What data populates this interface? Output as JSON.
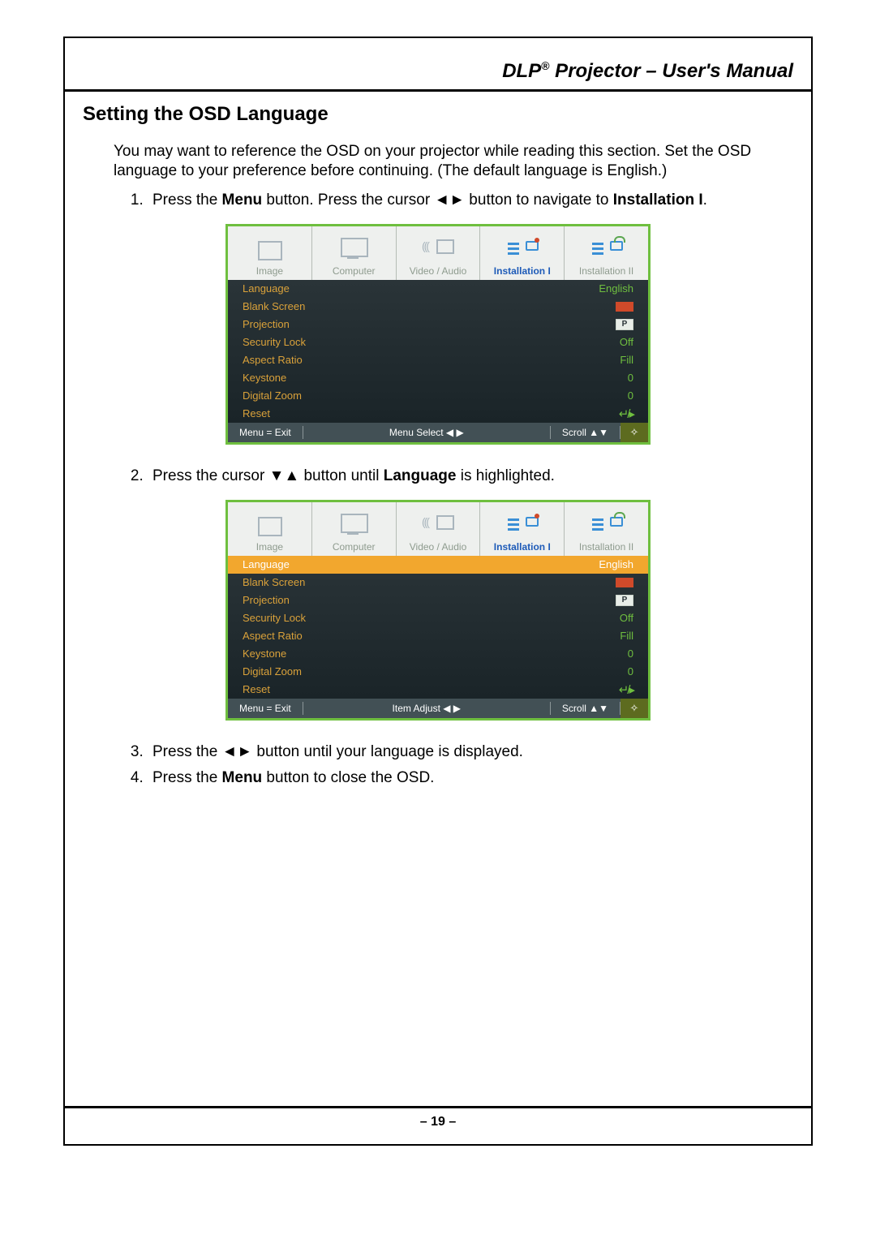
{
  "header": {
    "title_prefix": "DLP",
    "title_reg": "®",
    "title_suffix": " Projector – User's Manual"
  },
  "section_title": "Setting the OSD Language",
  "intro_para": "You may want to reference the OSD on your projector while reading this section. Set the OSD language to your preference before continuing. (The default language is English.)",
  "steps": {
    "s1_a": "Press the ",
    "s1_menu": "Menu",
    "s1_b": " button. Press the cursor ◄► button to navigate to ",
    "s1_inst": "Installation I",
    "s1_c": ".",
    "s2_a": "Press the cursor ▼▲ button until ",
    "s2_lang": "Language",
    "s2_b": " is highlighted.",
    "s3": "Press the ◄► button until your language is displayed.",
    "s4_a": "Press the ",
    "s4_menu": "Menu",
    "s4_b": " button to close the OSD."
  },
  "osd": {
    "tabs": {
      "image": "Image",
      "computer": "Computer",
      "va": "Video / Audio",
      "inst1": "Installation I",
      "inst2": "Installation II"
    },
    "rows": [
      {
        "label": "Language",
        "value": "English",
        "type": "text"
      },
      {
        "label": "Blank Screen",
        "value": "",
        "type": "swatch"
      },
      {
        "label": "Projection",
        "value": "P",
        "type": "proj"
      },
      {
        "label": "Security Lock",
        "value": "Off",
        "type": "text"
      },
      {
        "label": "Aspect Ratio",
        "value": "Fill",
        "type": "text"
      },
      {
        "label": "Keystone",
        "value": "0",
        "type": "text"
      },
      {
        "label": "Digital Zoom",
        "value": "0",
        "type": "text"
      },
      {
        "label": "Reset",
        "value": "↵/▸",
        "type": "enter"
      }
    ],
    "footer": {
      "exit": "Menu = Exit",
      "menuselect": "Menu Select ◀ ▶",
      "itemadjust": "Item Adjust ◀ ▶",
      "scroll": "Scroll ▲▼"
    }
  },
  "page_number": "– 19 –"
}
